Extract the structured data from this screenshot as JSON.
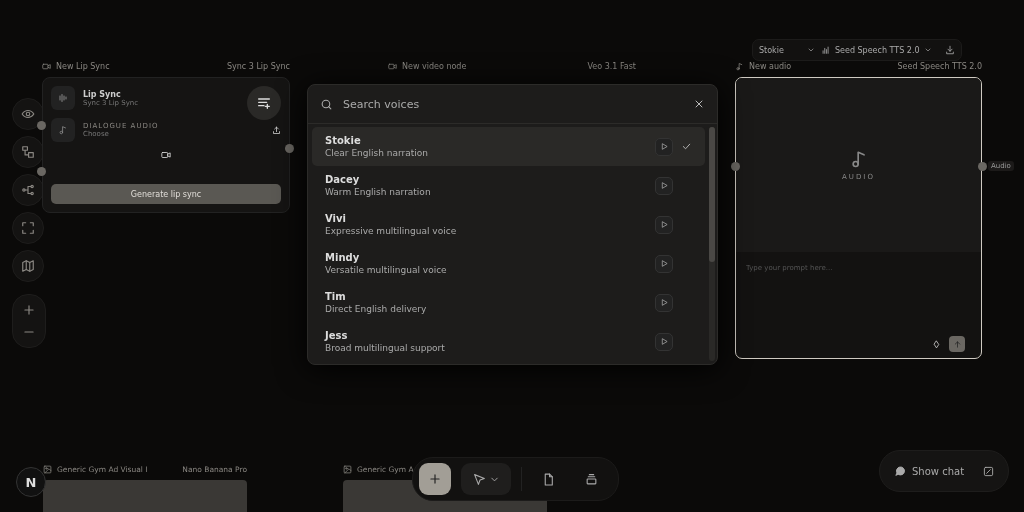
{
  "lip_sync_node": {
    "title": "New Lip Sync",
    "model": "Sync 3 Lip Sync",
    "name": "Lip Sync",
    "subtitle": "Sync 3 Lip Sync",
    "audio_label": "DIALOGUE AUDIO",
    "audio_value": "Choose",
    "generate_button": "Generate lip sync"
  },
  "video_node": {
    "title": "New video node",
    "model": "Veo 3.1 Fast"
  },
  "audio_node": {
    "title": "New audio",
    "model": "Seed Speech TTS 2.0",
    "toolbar_voice": "Stokie",
    "toolbar_model": "Seed Speech TTS 2.0",
    "placeholder_label": "AUDIO",
    "prompt_placeholder": "Type your prompt here...",
    "output_tag": "Audio"
  },
  "voice_picker": {
    "search_placeholder": "Search voices",
    "voices": [
      {
        "name": "Stokie",
        "description": "Clear English narration",
        "selected": true
      },
      {
        "name": "Dacey",
        "description": "Warm English narration",
        "selected": false
      },
      {
        "name": "Vivi",
        "description": "Expressive multilingual voice",
        "selected": false
      },
      {
        "name": "Mindy",
        "description": "Versatile multilingual voice",
        "selected": false
      },
      {
        "name": "Tim",
        "description": "Direct English delivery",
        "selected": false
      },
      {
        "name": "Jess",
        "description": "Broad multilingual support",
        "selected": false
      }
    ]
  },
  "image_nodes": [
    {
      "title": "Generic Gym Ad Visual I",
      "model": "Nano Banana Pro"
    },
    {
      "title": "Generic Gym A"
    }
  ],
  "logo": "N",
  "chat_button": "Show chat"
}
